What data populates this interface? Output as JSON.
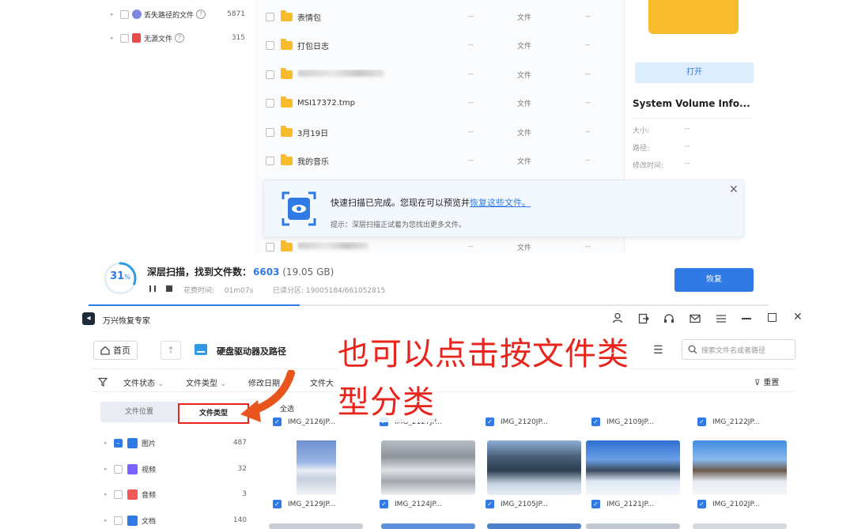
{
  "top": {
    "tree": [
      {
        "label": "丢失路径的文件",
        "count": "5871"
      },
      {
        "label": "无源文件",
        "count": "315"
      }
    ],
    "rows": [
      {
        "name": "表情包",
        "size": "--",
        "type": "文件",
        "date": "--"
      },
      {
        "name": "打包日志",
        "size": "--",
        "type": "文件",
        "date": "--"
      },
      {
        "name": "",
        "size": "--",
        "type": "文件",
        "date": "--"
      },
      {
        "name": "MSI17372.tmp",
        "size": "--",
        "type": "文件",
        "date": "--"
      },
      {
        "name": "3月19日",
        "size": "--",
        "type": "文件",
        "date": "--"
      },
      {
        "name": "我的音乐",
        "size": "--",
        "type": "文件",
        "date": "--"
      },
      {
        "name": "",
        "size": "--",
        "type": "文件",
        "date": "--"
      }
    ],
    "preview": {
      "open_label": "打开",
      "title": "System Volume Info...",
      "fields": [
        {
          "label": "大小:",
          "value": "--"
        },
        {
          "label": "路径:",
          "value": "--"
        },
        {
          "label": "修改时间:",
          "value": "--"
        }
      ]
    },
    "toast": {
      "message": "快速扫描已完成。您现在可以预览并",
      "link": "恢复这些文件。",
      "hint": "提示：深层扫描正试着为您找出更多文件。"
    },
    "scan": {
      "percent": "31",
      "percent_unit": "%",
      "progress": 0.31,
      "title": "深层扫描，找到文件数：",
      "count": "6603",
      "size": "(19.05 GB)",
      "elapsed_label": "花费时间:",
      "elapsed": "01m07s",
      "read_label": "已读分区:",
      "read": "19005184/661052815",
      "recover_label": "恢复"
    }
  },
  "bottom": {
    "app_title": "万兴恢复专家",
    "home_label": "首页",
    "drive_label": "硬盘驱动器及路径",
    "search_placeholder": "搜索文件名或者路径",
    "filters": [
      "文件状态",
      "文件类型",
      "修改日期",
      "文件大"
    ],
    "reset_label": "重置",
    "tabs": {
      "location": "文件位置",
      "type": "文件类型"
    },
    "select_all": "全选",
    "categories": [
      {
        "label": "图片",
        "count": "487",
        "color": "#2f7ae5"
      },
      {
        "label": "视频",
        "count": "32",
        "color": "#7b61ff"
      },
      {
        "label": "音频",
        "count": "3",
        "color": "#f05a5a"
      },
      {
        "label": "文档",
        "count": "140",
        "color": "#2f7ae5"
      }
    ],
    "top_cards": [
      "IMG_2126JP...",
      "IMG_2127JP...",
      "IMG_2120JP...",
      "IMG_2109JP...",
      "IMG_2122JP..."
    ],
    "mid_cards": [
      "IMG_2129JP...",
      "IMG_2124JP...",
      "IMG_2105JP...",
      "IMG_2121JP...",
      "IMG_2102JP..."
    ]
  },
  "annotation": {
    "line1": "也可以点击按文件类",
    "line2": "型分类",
    "color": "#e8241c"
  }
}
